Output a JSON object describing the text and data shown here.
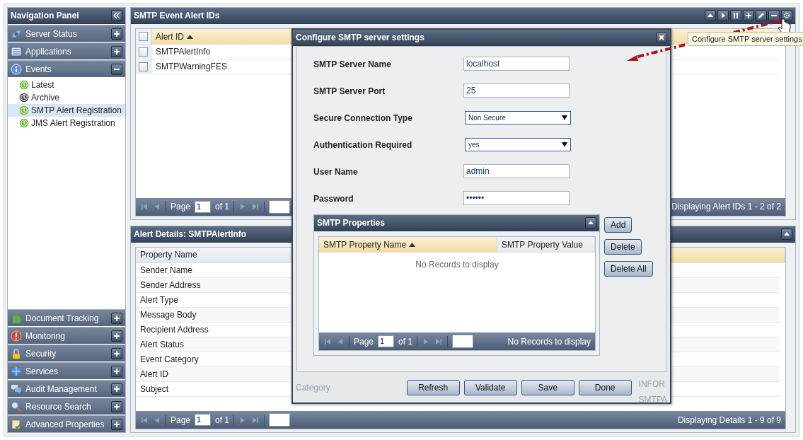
{
  "navigation_panel": {
    "title": "Navigation Panel",
    "sections_top": [
      {
        "label": "Server Status",
        "expanded": false
      },
      {
        "label": "Applications",
        "expanded": false
      },
      {
        "label": "Events",
        "expanded": true,
        "children": [
          {
            "label": "Latest",
            "selected": false,
            "color": "#6cbf3a"
          },
          {
            "label": "Archive",
            "selected": false,
            "color": "#555555"
          },
          {
            "label": "SMTP Alert Registration",
            "selected": true,
            "color": "#6cbf3a"
          },
          {
            "label": "JMS Alert Registration",
            "selected": false,
            "color": "#6cbf3a"
          }
        ]
      }
    ],
    "sections_bottom": [
      {
        "label": "Document Tracking",
        "expanded": false
      },
      {
        "label": "Monitoring",
        "expanded": false
      },
      {
        "label": "Security",
        "expanded": false
      },
      {
        "label": "Services",
        "expanded": false
      },
      {
        "label": "Audit Management",
        "expanded": false
      },
      {
        "label": "Resource Search",
        "expanded": false
      },
      {
        "label": "Advanced Properties",
        "expanded": false
      }
    ]
  },
  "alert_ids_panel": {
    "title": "SMTP Event Alert IDs",
    "columns": [
      {
        "label": "Alert ID",
        "sorted": true
      }
    ],
    "header_checked": false,
    "rows": [
      {
        "label": "SMTPAlertInfo",
        "checked": false
      },
      {
        "label": "SMTPWarningFES",
        "checked": false
      }
    ],
    "paging": {
      "page_label": "Page",
      "page": "1",
      "of": "of 1",
      "status": "Displaying Alert IDs 1 - 2 of 2"
    }
  },
  "tooltip": "Configure SMTP server settings",
  "alert_details_panel": {
    "title": "Alert Details: SMTPAlertInfo",
    "columns": [
      {
        "label": "Property Name",
        "sorted": false
      }
    ],
    "rows": [
      "Sender Name",
      "Sender Address",
      "Alert Type",
      "Message Body",
      "Recipient Address",
      "Alert Status",
      "Event Category",
      "Alert ID",
      "Subject"
    ],
    "paging": {
      "page_label": "Page",
      "page": "1",
      "of": "of 1",
      "status": "Displaying Details 1 - 9 of 9"
    }
  },
  "dialog": {
    "title": "Configure SMTP server settings",
    "fields": [
      {
        "label": "SMTP Server Name",
        "kind": "text",
        "value": "localhost"
      },
      {
        "label": "SMTP Server Port",
        "kind": "text",
        "value": "25"
      },
      {
        "label": "Secure Connection Type",
        "kind": "select",
        "value": "Non Secure"
      },
      {
        "label": "Authentication Required",
        "kind": "select",
        "value": "yes"
      },
      {
        "label": "User Name",
        "kind": "text",
        "value": "admin"
      },
      {
        "label": "Password",
        "kind": "text",
        "value": "••••••"
      }
    ],
    "properties": {
      "title": "SMTP Properties",
      "columns": [
        {
          "label": "SMTP Property Name",
          "sorted": true
        },
        {
          "label": "SMTP Property Value",
          "sorted": false
        }
      ],
      "empty_text": "No Records to display",
      "paging": {
        "page_label": "Page",
        "page": "1",
        "of": "of 1",
        "status": "No Records to display"
      },
      "buttons": [
        "Add",
        "Delete",
        "Delete All"
      ]
    },
    "buttons": [
      "Refresh",
      "Validate",
      "Save",
      "Done"
    ],
    "show_through": {
      "left": "Category",
      "right": [
        "INFOR",
        "SMTPA"
      ]
    }
  }
}
